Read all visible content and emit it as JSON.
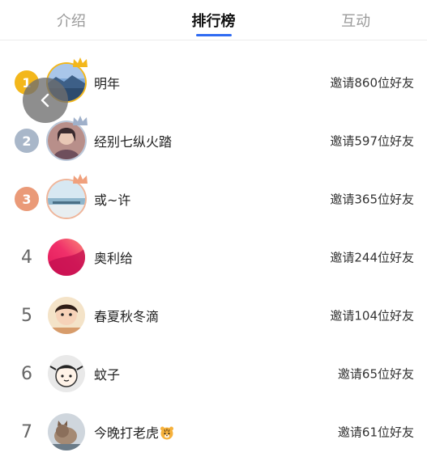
{
  "tabs": [
    {
      "label": "介绍",
      "active": false
    },
    {
      "label": "排行榜",
      "active": true
    },
    {
      "label": "互动",
      "active": false
    }
  ],
  "colors": {
    "accent": "#2f6bf2",
    "gold": "#f3b71b",
    "silver": "#a9b7c9",
    "bronze": "#ea9a78"
  },
  "ranking": [
    {
      "rank": "1",
      "name": "明年",
      "invite": "邀请860位好友",
      "medal": "gold",
      "crown": true,
      "avatar": "lake-photo"
    },
    {
      "rank": "2",
      "name": "经别七纵火踏",
      "invite": "邀请597位好友",
      "medal": "silver",
      "crown": true,
      "avatar": "person-photo"
    },
    {
      "rank": "3",
      "name": "或~许",
      "invite": "邀请365位好友",
      "medal": "bronze",
      "crown": true,
      "avatar": "sea-photo"
    },
    {
      "rank": "4",
      "name": "奥利给",
      "invite": "邀请244位好友",
      "medal": null,
      "crown": false,
      "avatar": "gradient-art"
    },
    {
      "rank": "5",
      "name": "春夏秋冬滴",
      "invite": "邀请104位好友",
      "medal": null,
      "crown": false,
      "avatar": "child-photo"
    },
    {
      "rank": "6",
      "name": "蚊子",
      "invite": "邀请65位好友",
      "medal": null,
      "crown": false,
      "avatar": "cartoon-kid"
    },
    {
      "rank": "7",
      "name": "今晚打老虎",
      "invite": "邀请61位好友",
      "medal": null,
      "crown": false,
      "avatar": "cat-photo",
      "name_emoji": "tiger-face-icon"
    }
  ],
  "back_button": {
    "icon": "chevron-left-icon"
  }
}
